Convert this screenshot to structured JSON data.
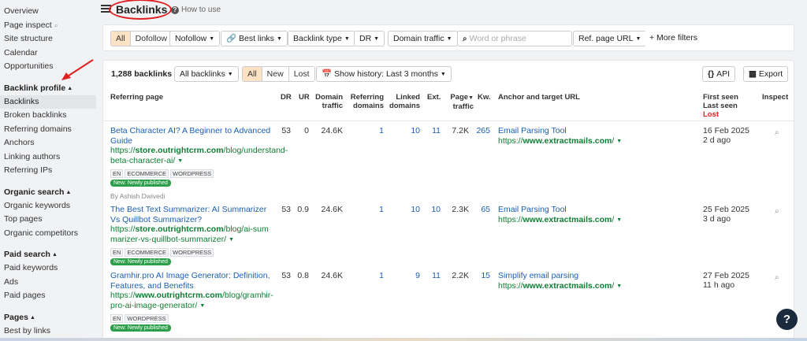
{
  "sidebar": {
    "top_items": [
      "Overview",
      "Page inspect",
      "Site structure",
      "Calendar",
      "Opportunities"
    ],
    "sections": [
      {
        "heading": "Backlink profile",
        "items": [
          "Backlinks",
          "Broken backlinks",
          "Referring domains",
          "Anchors",
          "Linking authors",
          "Referring IPs"
        ]
      },
      {
        "heading": "Organic search",
        "items": [
          "Organic keywords",
          "Top pages",
          "Organic competitors"
        ]
      },
      {
        "heading": "Paid search",
        "items": [
          "Paid keywords",
          "Ads",
          "Paid pages"
        ]
      },
      {
        "heading": "Pages",
        "items": [
          "Best by links"
        ]
      }
    ],
    "active_item": "Backlinks"
  },
  "header": {
    "title": "Backlinks",
    "how_to": "How to use"
  },
  "filters": {
    "link_type": [
      "All",
      "Dofollow"
    ],
    "nofollow": "Nofollow",
    "best_links": "Best links",
    "backlink_type": "Backlink type",
    "dr": "DR",
    "domain_traffic": "Domain traffic",
    "search_placeholder": "Word or phrase",
    "ref_page_url": "Ref. page URL",
    "more_filters": "+ More filters"
  },
  "table_toolbar": {
    "count": "1,288 backlinks",
    "scope": "All backlinks",
    "status_tabs": [
      "All",
      "New",
      "Lost"
    ],
    "history": "Show history: Last 3 months",
    "api": "API",
    "export": "Export"
  },
  "columns": {
    "referring_page": "Referring page",
    "dr": "DR",
    "ur": "UR",
    "domain_traffic": [
      "Domain",
      "traffic"
    ],
    "referring_domains": [
      "Referring",
      "domains"
    ],
    "linked_domains": [
      "Linked",
      "domains"
    ],
    "ext": "Ext.",
    "page_traffic": [
      "Page",
      "traffic"
    ],
    "kw": "Kw.",
    "anchor": "Anchor and target URL",
    "first_seen": "First seen",
    "last_seen": "Last seen",
    "lost": "Lost",
    "inspect": "Inspect"
  },
  "rows": [
    {
      "title": "Beta Character AI? A Beginner to Advanced Guide",
      "url_prefix": "https://",
      "url_domain": "store.outrightcrm.com",
      "url_path": "/blog/understand-beta-character-ai/",
      "tags": [
        "EN",
        "ECOMMERCE",
        "WORDPRESS"
      ],
      "badge": "New: Newly published",
      "author": "By Ashish Dwivedi",
      "dr": "53",
      "ur": "0",
      "domain_traffic": "24.6K",
      "ref_domains": "1",
      "linked_domains": "10",
      "ext": "11",
      "page_traffic": "7.2K",
      "kw": "265",
      "anchor": "Email Parsing Tool",
      "target_prefix": "https://",
      "target_domain": "www.extractmails.com",
      "target_path": "/",
      "first_seen": "16 Feb 2025",
      "last_seen": "2 d ago"
    },
    {
      "title": "The Best Text Summarizer: AI Summarizer Vs Quillbot Summarizer?",
      "url_prefix": "https://",
      "url_domain": "store.outrightcrm.com",
      "url_path": "/blog/ai-summarizer-vs-quillbot-summarizer/",
      "tags": [
        "EN",
        "ECOMMERCE",
        "WORDPRESS"
      ],
      "badge": "New: Newly published",
      "author": "",
      "dr": "53",
      "ur": "0.9",
      "domain_traffic": "24.6K",
      "ref_domains": "1",
      "linked_domains": "10",
      "ext": "10",
      "page_traffic": "2.3K",
      "kw": "65",
      "anchor": "Email Parsing Tool",
      "target_prefix": "https://",
      "target_domain": "www.extractmails.com",
      "target_path": "/",
      "first_seen": "25 Feb 2025",
      "last_seen": "3 d ago"
    },
    {
      "title": "Gramhir.pro AI Image Generator: Definition, Features, and Benefits",
      "url_prefix": "https://",
      "url_domain": "www.outrightcrm.com",
      "url_path": "/blog/gramhir-pro-ai-image-generator/",
      "tags": [
        "EN",
        "WORDPRESS"
      ],
      "badge": "New: Newly published",
      "author": "",
      "dr": "53",
      "ur": "0.8",
      "domain_traffic": "24.6K",
      "ref_domains": "1",
      "linked_domains": "9",
      "ext": "11",
      "page_traffic": "2.2K",
      "kw": "15",
      "anchor": "Simplify email parsing",
      "target_prefix": "https://",
      "target_domain": "www.extractmails.com",
      "target_path": "/",
      "first_seen": "27 Feb 2025",
      "last_seen": "11 h ago"
    }
  ],
  "colors": {
    "link": "#1a5fb4",
    "url": "#0e7d33",
    "active_filter": "#fde3c3",
    "lost": "#e02020",
    "annotation": "#e02020"
  }
}
